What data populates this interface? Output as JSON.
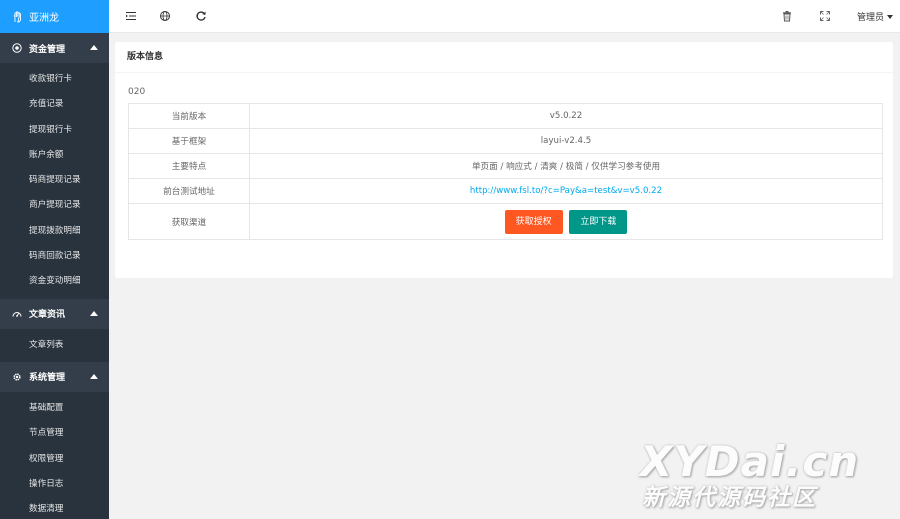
{
  "app": {
    "logo_text": "亚洲龙"
  },
  "sidebar": {
    "groups": [
      {
        "title": "资金管理",
        "icon": "target-icon",
        "items": [
          "收款银行卡",
          "充值记录",
          "提现银行卡",
          "账户余额",
          "码商提现记录",
          "商户提现记录",
          "提现拨款明细",
          "码商回款记录",
          "资金变动明细"
        ]
      },
      {
        "title": "文章资讯",
        "icon": "gauge-icon",
        "items": [
          "文章列表"
        ]
      },
      {
        "title": "系统管理",
        "icon": "gear-icon",
        "items": [
          "基础配置",
          "节点管理",
          "权限管理",
          "操作日志",
          "数据清理"
        ]
      }
    ]
  },
  "topbar": {
    "admin_label": "管理员"
  },
  "card": {
    "title": "版本信息",
    "subtitle": "020",
    "rows": [
      {
        "label": "当前版本",
        "value": "v5.0.22"
      },
      {
        "label": "基于框架",
        "value": "layui-v2.4.5"
      },
      {
        "label": "主要特点",
        "value": "单页面 / 响应式 / 清爽 / 极简 / 仅供学习参考使用"
      },
      {
        "label": "前台测试地址",
        "value": "http://www.fsl.to/?c=Pay&a=test&v=v5.0.22"
      }
    ],
    "channel_label": "获取渠道",
    "btn_auth": "获取授权",
    "btn_download": "立即下载"
  },
  "watermark": {
    "line1": "XYDai.cn",
    "line2": "新源代源码社区"
  },
  "colors": {
    "sidebar_bg": "#28333e",
    "logo_bg": "#1e9fff",
    "btn_orange": "#ff5722",
    "btn_green": "#009688",
    "link": "#01aaed"
  }
}
